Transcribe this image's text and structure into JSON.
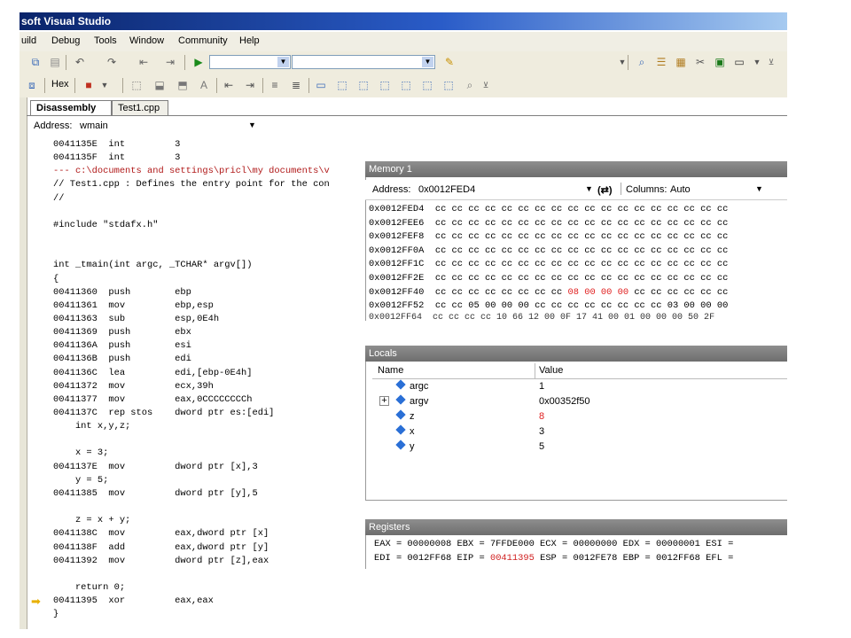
{
  "window": {
    "title": "soft Visual Studio"
  },
  "menu": {
    "items": [
      {
        "label": "uild",
        "ul": ""
      },
      {
        "label": "Debug",
        "ul": "D"
      },
      {
        "label": "Tools",
        "ul": "T"
      },
      {
        "label": "Window",
        "ul": "W"
      },
      {
        "label": "Community",
        "ul": "C"
      },
      {
        "label": "Help",
        "ul": "H"
      }
    ]
  },
  "toolbar2": {
    "hex_label": "Hex"
  },
  "tabs": [
    {
      "label": "Disassembly",
      "active": true
    },
    {
      "label": "Test1.cpp",
      "active": false
    }
  ],
  "address": {
    "label": "Address:",
    "value": "wmain"
  },
  "code_lines": [
    {
      "text": "0041135E  int         3",
      "red": false
    },
    {
      "text": "0041135F  int         3",
      "red": false
    },
    {
      "text": "--- c:\\documents and settings\\pricl\\my documents\\v",
      "red": true
    },
    {
      "text": "// Test1.cpp : Defines the entry point for the con",
      "red": false
    },
    {
      "text": "//",
      "red": false
    },
    {
      "text": "",
      "red": false
    },
    {
      "text": "#include \"stdafx.h\"",
      "red": false
    },
    {
      "text": "",
      "red": false
    },
    {
      "text": "",
      "red": false
    },
    {
      "text": "int _tmain(int argc, _TCHAR* argv[])",
      "red": false
    },
    {
      "text": "{",
      "red": false
    },
    {
      "text": "00411360  push        ebp",
      "red": false
    },
    {
      "text": "00411361  mov         ebp,esp",
      "red": false
    },
    {
      "text": "00411363  sub         esp,0E4h",
      "red": false
    },
    {
      "text": "00411369  push        ebx",
      "red": false
    },
    {
      "text": "0041136A  push        esi",
      "red": false
    },
    {
      "text": "0041136B  push        edi",
      "red": false
    },
    {
      "text": "0041136C  lea         edi,[ebp-0E4h]",
      "red": false
    },
    {
      "text": "00411372  mov         ecx,39h",
      "red": false
    },
    {
      "text": "00411377  mov         eax,0CCCCCCCCh",
      "red": false
    },
    {
      "text": "0041137C  rep stos    dword ptr es:[edi]",
      "red": false
    },
    {
      "text": "    int x,y,z;",
      "red": false
    },
    {
      "text": "",
      "red": false
    },
    {
      "text": "    x = 3;",
      "red": false
    },
    {
      "text": "0041137E  mov         dword ptr [x],3",
      "red": false
    },
    {
      "text": "    y = 5;",
      "red": false
    },
    {
      "text": "00411385  mov         dword ptr [y],5",
      "red": false
    },
    {
      "text": "",
      "red": false
    },
    {
      "text": "    z = x + y;",
      "red": false
    },
    {
      "text": "0041138C  mov         eax,dword ptr [x]",
      "red": false
    },
    {
      "text": "0041138F  add         eax,dword ptr [y]",
      "red": false
    },
    {
      "text": "00411392  mov         dword ptr [z],eax",
      "red": false
    },
    {
      "text": "",
      "red": false
    },
    {
      "text": "    return 0;",
      "red": false
    },
    {
      "text": "00411395  xor         eax,eax",
      "red": false
    },
    {
      "text": "}",
      "red": false
    }
  ],
  "memory": {
    "title": "Memory 1",
    "address_label": "Address:",
    "address_value": "0x0012FED4",
    "columns_label": "Columns:",
    "columns_value": "Auto",
    "rows": [
      {
        "addr": "0x0012FED4",
        "bytes": "cc cc cc cc cc cc cc cc cc cc cc cc cc cc cc cc cc cc",
        "hl": ""
      },
      {
        "addr": "0x0012FEE6",
        "bytes": "cc cc cc cc cc cc cc cc cc cc cc cc cc cc cc cc cc cc",
        "hl": ""
      },
      {
        "addr": "0x0012FEF8",
        "bytes": "cc cc cc cc cc cc cc cc cc cc cc cc cc cc cc cc cc cc",
        "hl": ""
      },
      {
        "addr": "0x0012FF0A",
        "bytes": "cc cc cc cc cc cc cc cc cc cc cc cc cc cc cc cc cc cc",
        "hl": ""
      },
      {
        "addr": "0x0012FF1C",
        "bytes": "cc cc cc cc cc cc cc cc cc cc cc cc cc cc cc cc cc cc",
        "hl": ""
      },
      {
        "addr": "0x0012FF2E",
        "bytes": "cc cc cc cc cc cc cc cc cc cc cc cc cc cc cc cc cc cc",
        "hl": ""
      },
      {
        "addr": "0x0012FF40",
        "bytes_pre": "cc cc cc cc cc cc cc cc ",
        "bytes_hl": "08 00 00 00",
        "bytes_post": " cc cc cc cc cc cc"
      },
      {
        "addr": "0x0012FF52",
        "bytes": "cc cc 05 00 00 00 cc cc cc cc cc cc cc cc 03 00 00 00",
        "hl": ""
      }
    ]
  },
  "locals": {
    "title": "Locals",
    "col_name": "Name",
    "col_value": "Value",
    "rows": [
      {
        "name": "argc",
        "value": "1",
        "changed": false,
        "expandable": false
      },
      {
        "name": "argv",
        "value": "0x00352f50",
        "changed": false,
        "expandable": true
      },
      {
        "name": "z",
        "value": "8",
        "changed": true,
        "expandable": false
      },
      {
        "name": "x",
        "value": "3",
        "changed": false,
        "expandable": false
      },
      {
        "name": "y",
        "value": "5",
        "changed": false,
        "expandable": false
      }
    ]
  },
  "registers": {
    "title": "Registers",
    "line1": "EAX = 00000008 EBX = 7FFDE000 ECX = 00000000 EDX = 00000001 ESI =",
    "line2_pre": "EDI = 0012FF68 EIP = ",
    "line2_hl": "00411395",
    "line2_post": " ESP = 0012FE78 EBP = 0012FF68 EFL ="
  },
  "colors": {
    "changed_value": "#e02020",
    "source_red": "#b01818"
  }
}
